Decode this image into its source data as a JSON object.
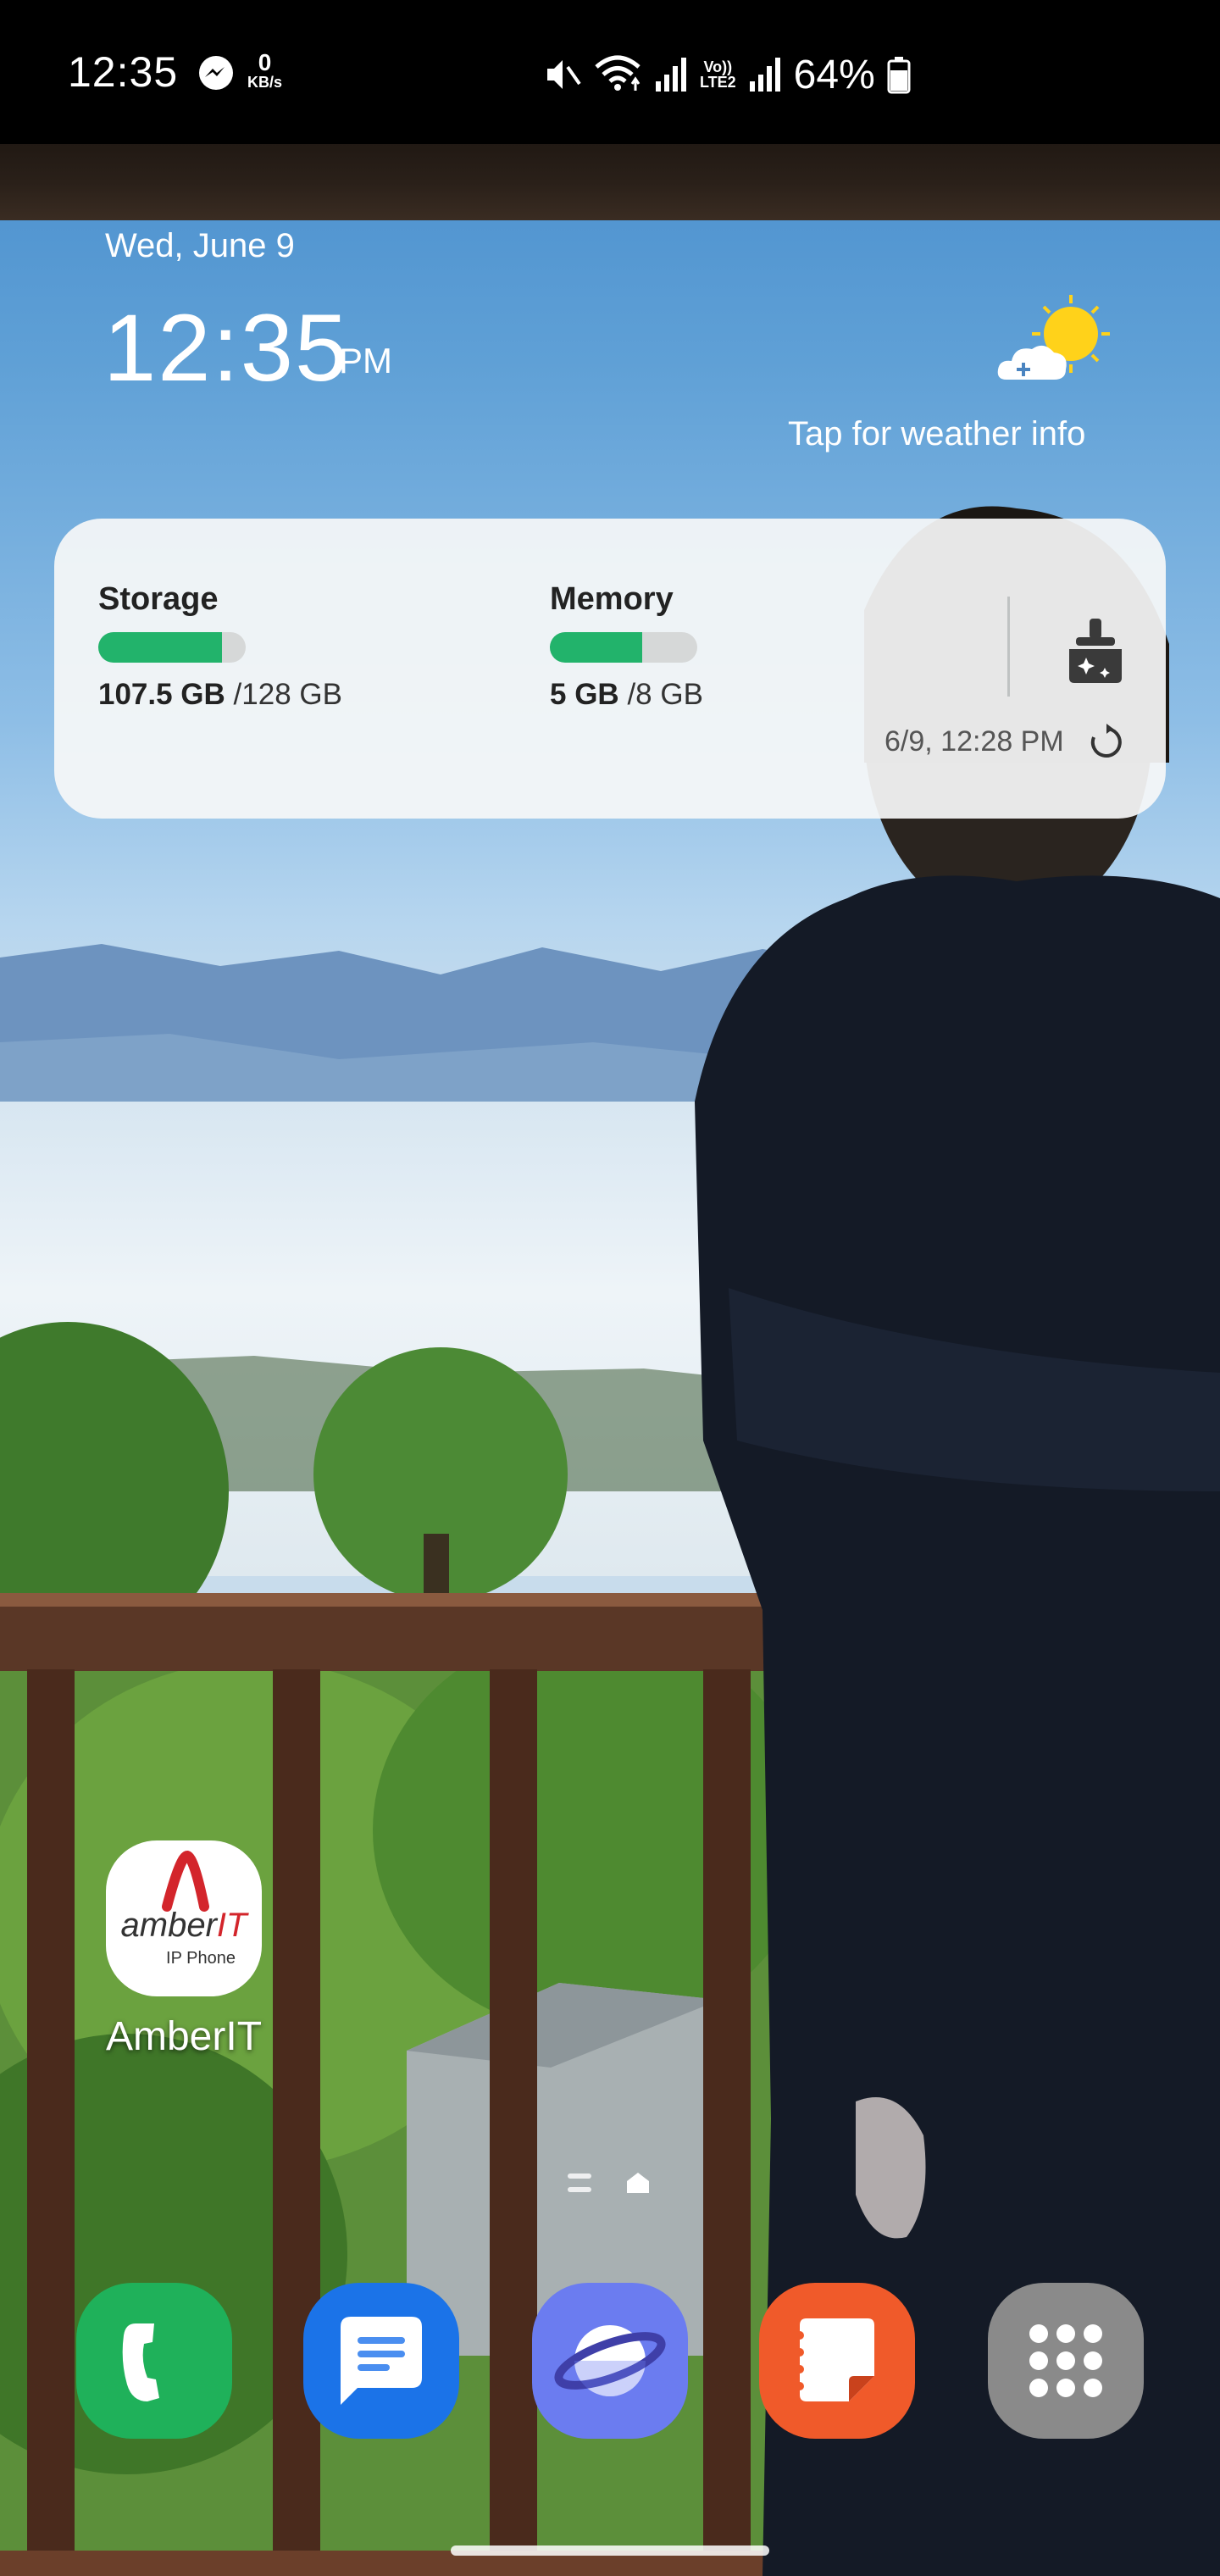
{
  "status_bar": {
    "time": "12:35",
    "net_speed_value": "0",
    "net_speed_unit": "KB/s",
    "volte_top": "Vo))",
    "volte_bottom": "LTE2",
    "battery_percent": "64%"
  },
  "lockscreen_widget": {
    "date": "Wed, June 9",
    "time": "12:35",
    "ampm": "PM",
    "weather_hint": "Tap for weather info"
  },
  "device_care": {
    "storage_label": "Storage",
    "storage_used": "107.5 GB",
    "storage_total": "/128 GB",
    "storage_fraction": 0.84,
    "memory_label": "Memory",
    "memory_used": "5 GB",
    "memory_total": "/8 GB",
    "memory_fraction": 0.625,
    "last_updated": "6/9, 12:28 PM",
    "accent_color": "#22b36b"
  },
  "home_apps": [
    {
      "label": "AmberIT",
      "brand_prefix": "amber",
      "brand_suffix": "IT",
      "subtitle": "IP Phone",
      "icon": "amberit-icon"
    }
  ],
  "dock": [
    {
      "name": "phone",
      "icon": "phone-icon",
      "color": "#1fb15a"
    },
    {
      "name": "messages",
      "icon": "message-icon",
      "color": "#1b73e8"
    },
    {
      "name": "internet",
      "icon": "browser-icon",
      "color": "#6b7cf0"
    },
    {
      "name": "notes",
      "icon": "notes-icon",
      "color": "#f05a2a"
    },
    {
      "name": "apps",
      "icon": "app-drawer-icon",
      "color": "#8a8a8a"
    }
  ]
}
